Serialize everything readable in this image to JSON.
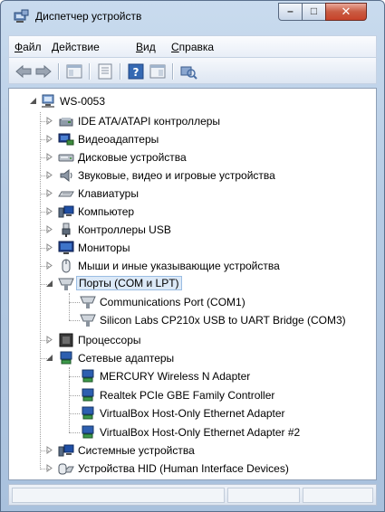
{
  "window": {
    "title": "Диспетчер устройств",
    "icon": "device-manager-icon",
    "buttons": {
      "minimize": "–",
      "maximize": "□",
      "close": "✕"
    }
  },
  "menu": {
    "file": {
      "accel": "Ф",
      "rest": "айл"
    },
    "action": {
      "accel": "Д",
      "rest": "ействие"
    },
    "view": {
      "accel": "В",
      "rest": "ид"
    },
    "help": {
      "accel": "С",
      "rest": "правка"
    }
  },
  "toolbar": {
    "icons": [
      "back-arrow-icon",
      "forward-arrow-icon",
      "show-hide-console-tree-icon",
      "properties-icon",
      "help-icon",
      "view-icon",
      "scan-hardware-icon"
    ]
  },
  "tree": {
    "root": "WS-0053",
    "nodes": [
      {
        "label": "IDE ATA/ATAPI контроллеры",
        "icon": "ide-controller-icon",
        "state": "collapsed"
      },
      {
        "label": "Видеоадаптеры",
        "icon": "display-adapter-icon",
        "state": "collapsed"
      },
      {
        "label": "Дисковые устройства",
        "icon": "disk-drive-icon",
        "state": "collapsed"
      },
      {
        "label": "Звуковые, видео и игровые устройства",
        "icon": "speaker-icon",
        "state": "collapsed"
      },
      {
        "label": "Клавиатуры",
        "icon": "keyboard-icon",
        "state": "collapsed"
      },
      {
        "label": "Компьютер",
        "icon": "computer-icon",
        "state": "collapsed"
      },
      {
        "label": "Контроллеры USB",
        "icon": "usb-plug-icon",
        "state": "collapsed"
      },
      {
        "label": "Мониторы",
        "icon": "monitor-icon",
        "state": "collapsed"
      },
      {
        "label": "Мыши и иные указывающие устройства",
        "icon": "mouse-icon",
        "state": "collapsed"
      },
      {
        "label": "Порты (COM и LPT)",
        "icon": "port-icon",
        "state": "expanded",
        "selected": true,
        "children": [
          "Communications Port (COM1)",
          "Silicon Labs CP210x USB to UART Bridge (COM3)"
        ]
      },
      {
        "label": "Процессоры",
        "icon": "processor-icon",
        "state": "collapsed"
      },
      {
        "label": "Сетевые адаптеры",
        "icon": "network-adapter-icon",
        "state": "expanded",
        "children": [
          "MERCURY Wireless N Adapter",
          "Realtek PCIe GBE Family Controller",
          "VirtualBox Host-Only Ethernet Adapter",
          "VirtualBox Host-Only Ethernet Adapter #2"
        ]
      },
      {
        "label": "Системные устройства",
        "icon": "system-devices-icon",
        "state": "collapsed"
      },
      {
        "label": "Устройства HID (Human Interface Devices)",
        "icon": "hid-icon",
        "state": "collapsed"
      }
    ]
  },
  "colors": {
    "titlebar": "#b9cde6",
    "selection": "#dce9f7",
    "close_button": "#c7432a"
  }
}
